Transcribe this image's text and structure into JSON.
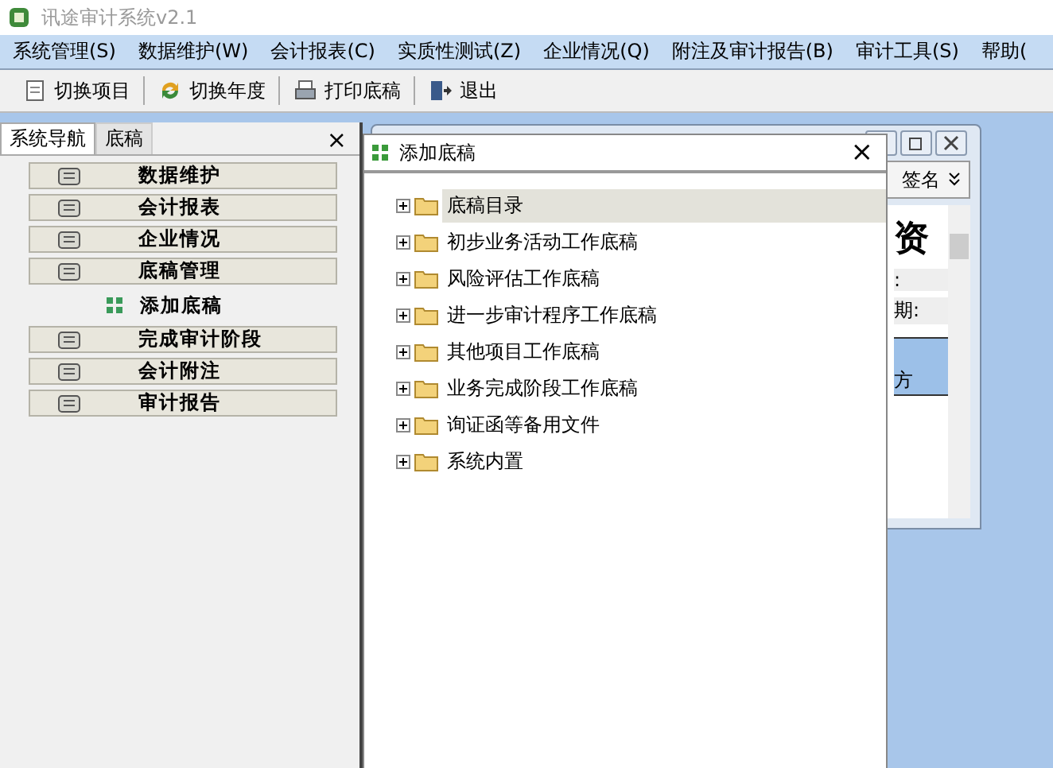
{
  "window": {
    "title": "讯途审计系统v2.1"
  },
  "menu": [
    "系统管理(S)",
    "数据维护(W)",
    "会计报表(C)",
    "实质性测试(Z)",
    "企业情况(Q)",
    "附注及审计报告(B)",
    "审计工具(S)",
    "帮助("
  ],
  "toolbar": [
    {
      "label": "切换项目",
      "kind": "doc"
    },
    {
      "label": "切换年度",
      "kind": "cycle"
    },
    {
      "label": "打印底稿",
      "kind": "print"
    },
    {
      "label": "退出",
      "kind": "exit"
    }
  ],
  "nav_panel": {
    "tabs": [
      {
        "label": "系统导航",
        "selected": true
      },
      {
        "label": "底稿",
        "selected": false
      }
    ],
    "close": "×",
    "items": [
      {
        "label": "数据维护",
        "kind": "group"
      },
      {
        "label": "会计报表",
        "kind": "group"
      },
      {
        "label": "企业情况",
        "kind": "group"
      },
      {
        "label": "底稿管理",
        "kind": "group"
      },
      {
        "label": "添加底稿",
        "kind": "sub"
      },
      {
        "label": "完成审计阶段",
        "kind": "group"
      },
      {
        "label": "会计附注",
        "kind": "group"
      },
      {
        "label": "审计报告",
        "kind": "group"
      }
    ]
  },
  "back_window": {
    "toolbar_text": "签名",
    "heading": "资",
    "fields": [
      ":",
      "期:"
    ],
    "cell": "方"
  },
  "dialog": {
    "title": "添加底稿",
    "close": "×",
    "tree": [
      {
        "label": "底稿目录",
        "selected": true,
        "expanded": false
      },
      {
        "label": "初步业务活动工作底稿",
        "selected": false,
        "expanded": false
      },
      {
        "label": "风险评估工作底稿",
        "selected": false,
        "expanded": false
      },
      {
        "label": "进一步审计程序工作底稿",
        "selected": false,
        "expanded": false
      },
      {
        "label": "其他项目工作底稿",
        "selected": false,
        "expanded": false
      },
      {
        "label": "业务完成阶段工作底稿",
        "selected": false,
        "expanded": false
      },
      {
        "label": "询证函等备用文件",
        "selected": false,
        "expanded": false
      },
      {
        "label": "系统内置",
        "selected": false,
        "expanded": false
      }
    ]
  }
}
